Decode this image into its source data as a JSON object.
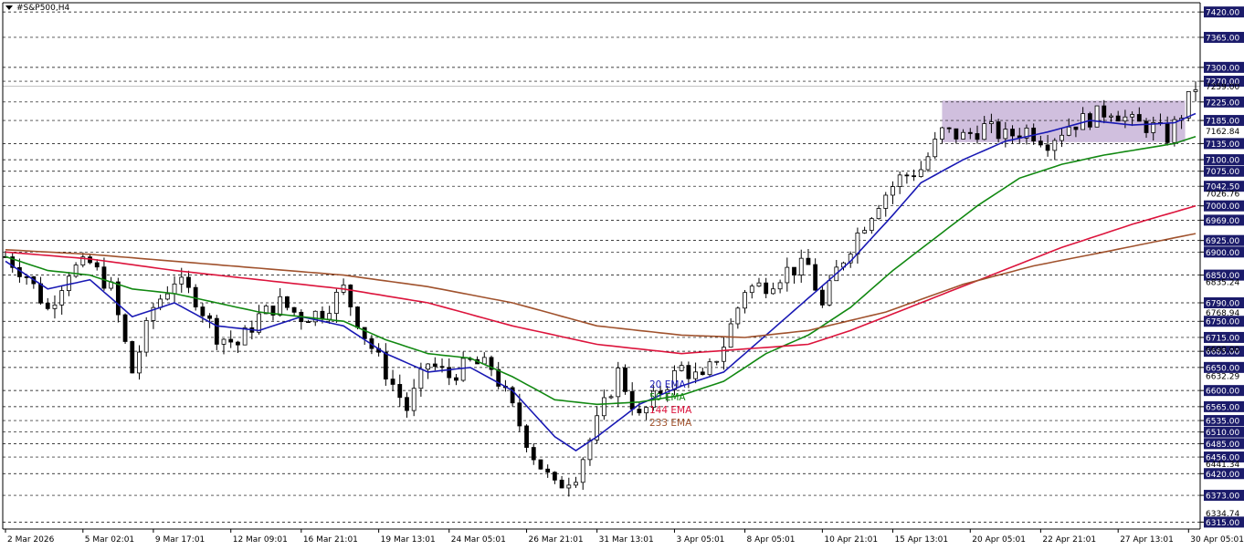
{
  "chart_data": {
    "type": "candlestick",
    "title": "#S&P500,H4",
    "yaxis": {
      "ylim": [
        6300,
        7440
      ],
      "levels": [
        7420.0,
        7365.0,
        7300.0,
        7270.0,
        7225.0,
        7185.0,
        7135.0,
        7100.0,
        7075.0,
        7042.5,
        7000.0,
        6969.0,
        6925.0,
        6900.0,
        6850.0,
        6790.0,
        6750.0,
        6715.0,
        6685.0,
        6650.0,
        6600.0,
        6565.0,
        6535.0,
        6510.0,
        6485.0,
        6456.0,
        6420.0,
        6373.0,
        6315.0
      ],
      "level_labels": [
        "7420.00",
        "7365.00",
        "7300.00",
        "7270.00",
        "7225.00",
        "7185.00",
        "7135.00",
        "7100.00",
        "7075.00",
        "7042.50",
        "7000.00",
        "6969.00",
        "6925.00",
        "6900.00",
        "6850.00",
        "6790.00",
        "6750.00",
        "6715.00",
        "6685.00",
        "6650.00",
        "6600.00",
        "6565.00",
        "6535.00",
        "6510.00",
        "6485.00",
        "6456.00",
        "6420.00",
        "6373.00",
        "6315.00"
      ],
      "extra_labels": [
        {
          "value": 7259.0,
          "label": "7259.00"
        },
        {
          "value": 7162.84,
          "label": "7162.84"
        },
        {
          "value": 7026.76,
          "label": "7026.76"
        },
        {
          "value": 6835.24,
          "label": "6835.24"
        },
        {
          "value": 6768.94,
          "label": "6768.94"
        },
        {
          "value": 6690.0,
          "label": "6690.00"
        },
        {
          "value": 6632.29,
          "label": "6632.29"
        },
        {
          "value": 6441.34,
          "label": "6441.34"
        },
        {
          "value": 6334.74,
          "label": "6334.74"
        }
      ],
      "current_price": 7259.0
    },
    "xaxis": {
      "count": 170,
      "ticks": [
        {
          "i": 0,
          "label": "2 Mar 2026"
        },
        {
          "i": 11,
          "label": "5 Mar 02:01"
        },
        {
          "i": 21,
          "label": "9 Mar 17:01"
        },
        {
          "i": 32,
          "label": "12 Mar 09:01"
        },
        {
          "i": 42,
          "label": "16 Mar 21:01"
        },
        {
          "i": 53,
          "label": "19 Mar 13:01"
        },
        {
          "i": 63,
          "label": "24 Mar 05:01"
        },
        {
          "i": 74,
          "label": "26 Mar 21:01"
        },
        {
          "i": 84,
          "label": "31 Mar 13:01"
        },
        {
          "i": 95,
          "label": "3 Apr 05:01"
        },
        {
          "i": 105,
          "label": "8 Apr 05:01"
        },
        {
          "i": 116,
          "label": "10 Apr 21:01"
        },
        {
          "i": 126,
          "label": "15 Apr 13:01"
        },
        {
          "i": 137,
          "label": "20 Apr 05:01"
        },
        {
          "i": 147,
          "label": "22 Apr 21:01"
        },
        {
          "i": 158,
          "label": "27 Apr 13:01"
        },
        {
          "i": 168,
          "label": "30 Apr 05:01"
        }
      ]
    },
    "price_anchors": [
      [
        0,
        6890
      ],
      [
        3,
        6850
      ],
      [
        6,
        6775
      ],
      [
        9,
        6860
      ],
      [
        12,
        6875
      ],
      [
        15,
        6820
      ],
      [
        18,
        6640
      ],
      [
        21,
        6780
      ],
      [
        24,
        6840
      ],
      [
        27,
        6800
      ],
      [
        30,
        6720
      ],
      [
        33,
        6700
      ],
      [
        36,
        6760
      ],
      [
        39,
        6790
      ],
      [
        42,
        6760
      ],
      [
        45,
        6770
      ],
      [
        48,
        6820
      ],
      [
        51,
        6720
      ],
      [
        54,
        6640
      ],
      [
        57,
        6560
      ],
      [
        60,
        6660
      ],
      [
        63,
        6630
      ],
      [
        66,
        6660
      ],
      [
        69,
        6650
      ],
      [
        72,
        6560
      ],
      [
        75,
        6460
      ],
      [
        78,
        6390
      ],
      [
        81,
        6420
      ],
      [
        84,
        6530
      ],
      [
        87,
        6640
      ],
      [
        90,
        6540
      ],
      [
        93,
        6600
      ],
      [
        96,
        6650
      ],
      [
        99,
        6620
      ],
      [
        102,
        6700
      ],
      [
        105,
        6820
      ],
      [
        108,
        6830
      ],
      [
        111,
        6860
      ],
      [
        114,
        6870
      ],
      [
        116,
        6780
      ],
      [
        118,
        6860
      ],
      [
        121,
        6940
      ],
      [
        124,
        7010
      ],
      [
        127,
        7060
      ],
      [
        130,
        7080
      ],
      [
        133,
        7160
      ],
      [
        136,
        7150
      ],
      [
        139,
        7170
      ],
      [
        142,
        7150
      ],
      [
        145,
        7165
      ],
      [
        148,
        7140
      ],
      [
        151,
        7175
      ],
      [
        154,
        7190
      ],
      [
        157,
        7210
      ],
      [
        160,
        7180
      ],
      [
        163,
        7170
      ],
      [
        165,
        7150
      ],
      [
        167,
        7200
      ],
      [
        169,
        7259
      ]
    ],
    "box": {
      "i0": 133,
      "i1": 170,
      "top": 7228,
      "bottom": 7138,
      "color": "#c8b4d8"
    },
    "series": [
      {
        "name": "20 EMA",
        "color": "#1919b4",
        "anchors": [
          [
            0,
            6880
          ],
          [
            6,
            6820
          ],
          [
            12,
            6840
          ],
          [
            18,
            6760
          ],
          [
            24,
            6790
          ],
          [
            30,
            6740
          ],
          [
            36,
            6730
          ],
          [
            42,
            6760
          ],
          [
            48,
            6740
          ],
          [
            54,
            6680
          ],
          [
            60,
            6640
          ],
          [
            66,
            6650
          ],
          [
            72,
            6600
          ],
          [
            78,
            6500
          ],
          [
            81,
            6470
          ],
          [
            84,
            6500
          ],
          [
            90,
            6570
          ],
          [
            96,
            6610
          ],
          [
            102,
            6640
          ],
          [
            108,
            6720
          ],
          [
            114,
            6800
          ],
          [
            120,
            6880
          ],
          [
            126,
            6980
          ],
          [
            130,
            7050
          ],
          [
            136,
            7100
          ],
          [
            142,
            7140
          ],
          [
            148,
            7160
          ],
          [
            154,
            7185
          ],
          [
            160,
            7175
          ],
          [
            166,
            7180
          ],
          [
            169,
            7200
          ]
        ]
      },
      {
        "name": "50 EMA",
        "color": "#118811",
        "anchors": [
          [
            0,
            6890
          ],
          [
            6,
            6860
          ],
          [
            12,
            6850
          ],
          [
            18,
            6820
          ],
          [
            24,
            6810
          ],
          [
            30,
            6790
          ],
          [
            36,
            6770
          ],
          [
            42,
            6760
          ],
          [
            48,
            6750
          ],
          [
            54,
            6710
          ],
          [
            60,
            6680
          ],
          [
            66,
            6670
          ],
          [
            72,
            6630
          ],
          [
            78,
            6580
          ],
          [
            84,
            6570
          ],
          [
            90,
            6575
          ],
          [
            96,
            6590
          ],
          [
            102,
            6620
          ],
          [
            108,
            6680
          ],
          [
            114,
            6720
          ],
          [
            120,
            6780
          ],
          [
            126,
            6860
          ],
          [
            132,
            6930
          ],
          [
            138,
            7000
          ],
          [
            144,
            7060
          ],
          [
            150,
            7090
          ],
          [
            156,
            7110
          ],
          [
            162,
            7125
          ],
          [
            166,
            7135
          ],
          [
            169,
            7150
          ]
        ]
      },
      {
        "name": "144 EMA",
        "color": "#dc143c",
        "anchors": [
          [
            0,
            6900
          ],
          [
            12,
            6885
          ],
          [
            24,
            6860
          ],
          [
            36,
            6840
          ],
          [
            48,
            6820
          ],
          [
            60,
            6790
          ],
          [
            72,
            6740
          ],
          [
            84,
            6700
          ],
          [
            96,
            6680
          ],
          [
            105,
            6690
          ],
          [
            114,
            6700
          ],
          [
            120,
            6730
          ],
          [
            130,
            6790
          ],
          [
            140,
            6850
          ],
          [
            150,
            6910
          ],
          [
            160,
            6960
          ],
          [
            169,
            7000
          ]
        ]
      },
      {
        "name": "233 EMA",
        "color": "#a0522d",
        "anchors": [
          [
            0,
            6905
          ],
          [
            12,
            6895
          ],
          [
            24,
            6880
          ],
          [
            36,
            6865
          ],
          [
            48,
            6850
          ],
          [
            60,
            6825
          ],
          [
            72,
            6790
          ],
          [
            84,
            6740
          ],
          [
            96,
            6720
          ],
          [
            105,
            6715
          ],
          [
            114,
            6730
          ],
          [
            125,
            6770
          ],
          [
            136,
            6830
          ],
          [
            146,
            6870
          ],
          [
            156,
            6900
          ],
          [
            169,
            6940
          ]
        ]
      }
    ],
    "legend": {
      "placement": "center",
      "entries": [
        "20 EMA",
        "50 EMA",
        "144 EMA",
        "233 EMA"
      ]
    },
    "candle_color": "#000000"
  }
}
